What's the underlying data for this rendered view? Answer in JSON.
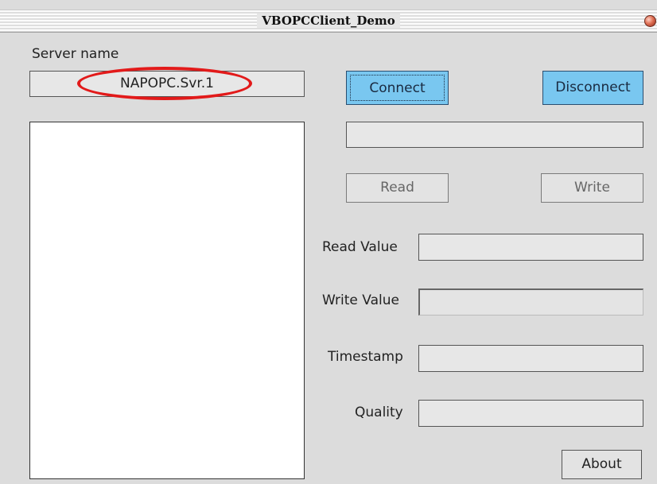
{
  "window": {
    "title": "VBOPCClient_Demo",
    "close_icon": "close-circle-icon"
  },
  "server": {
    "label": "Server name",
    "value": "NAPOPC.Svr.1",
    "highlight_color": "#e21a1a"
  },
  "buttons": {
    "connect": "Connect",
    "disconnect": "Disconnect",
    "read": "Read",
    "write": "Write",
    "about": "About",
    "accent_color": "#79c7f0"
  },
  "fields": {
    "status": "",
    "read_value_label": "Read Value",
    "read_value": "",
    "write_value_label": "Write Value",
    "write_value": "",
    "timestamp_label": "Timestamp",
    "timestamp": "",
    "quality_label": "Quality",
    "quality": ""
  },
  "item_list": []
}
